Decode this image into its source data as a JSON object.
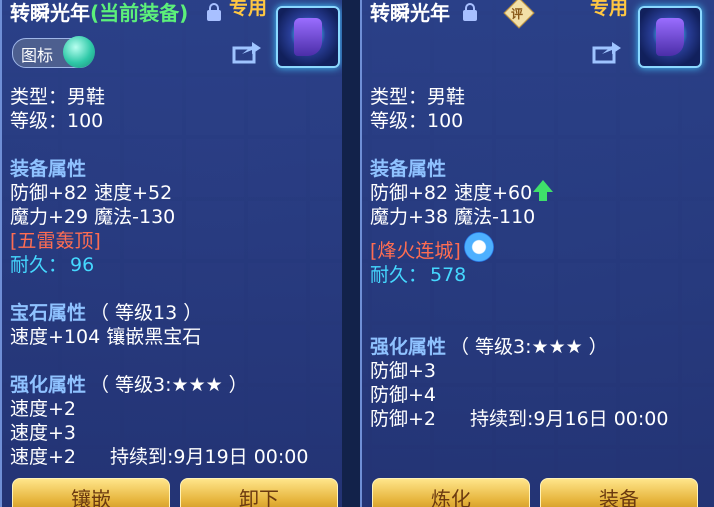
{
  "left": {
    "title": "转瞬光年",
    "status_tag": "(当前装备)",
    "exclusive_tag": "专用",
    "icon_toggle_label": "图标",
    "type_line": "类型：男鞋",
    "level_line": "等级：100",
    "equip_section": "装备属性",
    "attr_line1": "防御+82 速度+52",
    "attr_line2": "魔力+29 魔法-130",
    "special_effect": "[五雷轰顶]",
    "durability_label": "耐久：",
    "durability_value": "96",
    "gem_section": "宝石属性",
    "gem_level": "（ 等级13 ）",
    "gem_line": "速度+104 镶嵌黑宝石",
    "enhance_section": "强化属性",
    "enhance_level": "（ 等级3:★★★ ）",
    "enhance_line1": "速度+2",
    "enhance_line2": "速度+3",
    "enhance_line3": "速度+2",
    "enhance_expiry": "持续到:9月19日 00:00",
    "button_left": "镶嵌",
    "button_right": "卸下"
  },
  "right": {
    "title": "转瞬光年",
    "rating_badge": "评",
    "exclusive_tag": "专用",
    "type_line": "类型：男鞋",
    "level_line": "等级：100",
    "equip_section": "装备属性",
    "attr_line1": "防御+82 速度+60",
    "attr_line2": "魔力+38 魔法-110",
    "special_effect": "[烽火连城]",
    "durability_label": "耐久：",
    "durability_value": "578",
    "enhance_section": "强化属性",
    "enhance_level": "（ 等级3:★★★ ）",
    "enhance_line1": "防御+3",
    "enhance_line2": "防御+4",
    "enhance_line3": "防御+2",
    "enhance_expiry": "持续到:9月16日 00:00",
    "button_left": "炼化",
    "button_right": "装备"
  },
  "icons": [
    "lock-icon",
    "share-icon",
    "boots-item-icon",
    "up-arrow-icon",
    "refresh-icon",
    "rating-badge-icon"
  ],
  "colors": {
    "panel": "#2c428c",
    "title_green": "#5cf07a",
    "effect_red": "#ff6d52",
    "durability_cyan": "#45d8ff",
    "section_blue": "#8fc2ff",
    "gold": "#ffc742"
  }
}
